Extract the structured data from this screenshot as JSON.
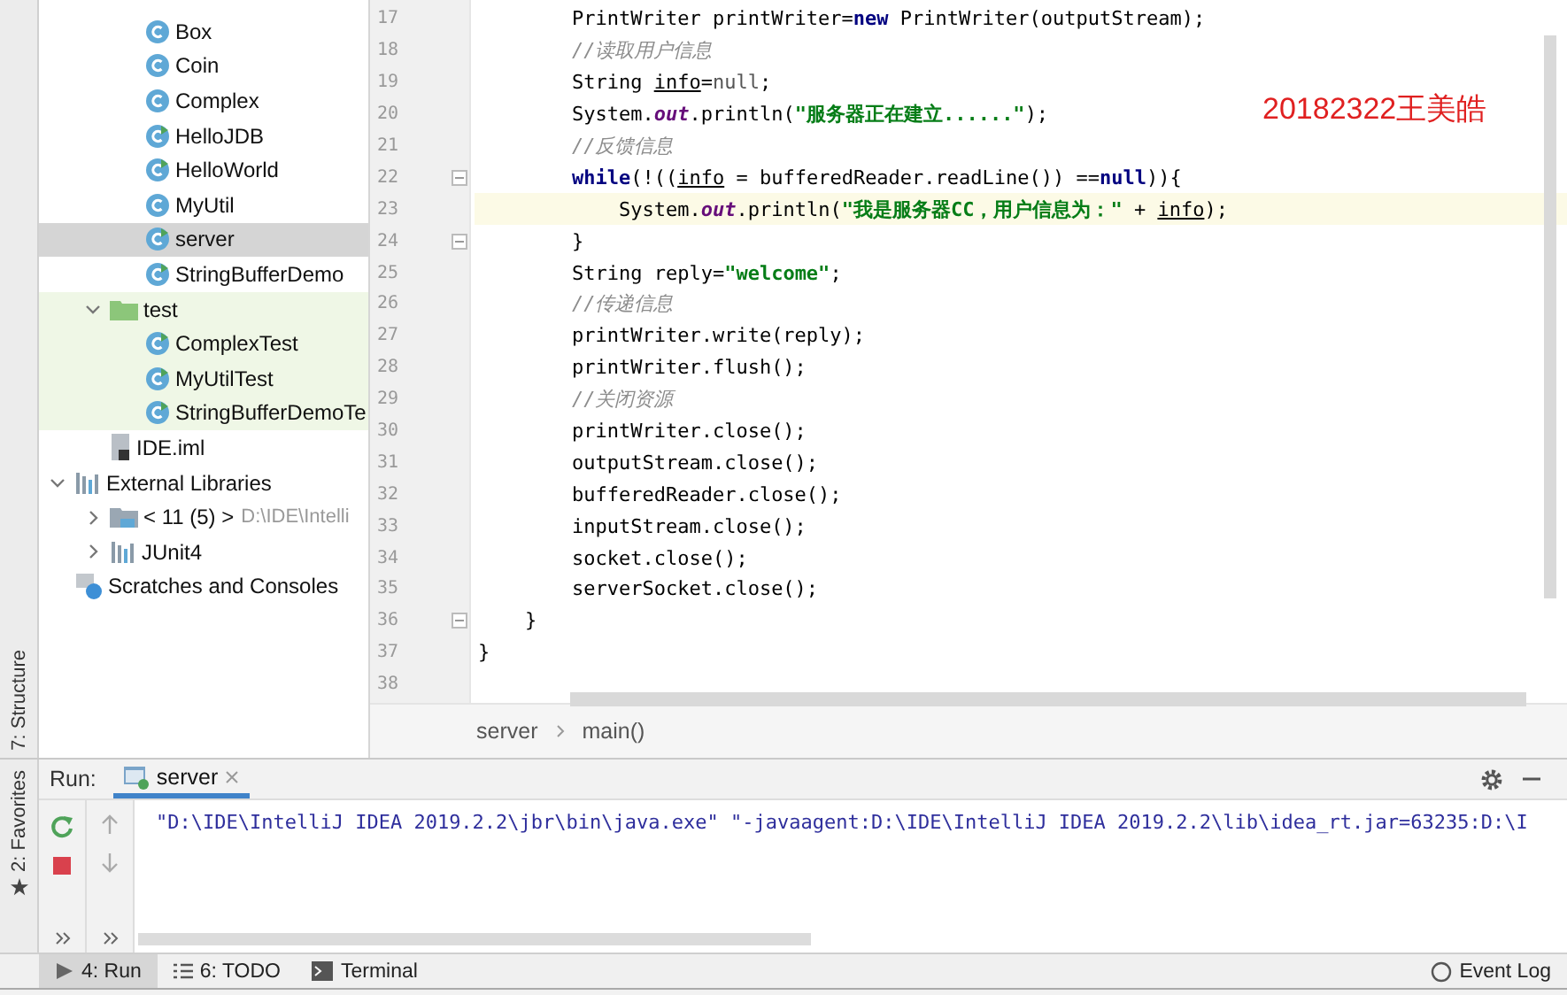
{
  "side_strip": {
    "top_tool": "7: Structure",
    "bottom_tool": "2: Favorites"
  },
  "project_tree": [
    {
      "children": [
        {
          "children": [
            {
              "label": "Box",
              "kind": "class",
              "selected": false
            },
            {
              "label": "Coin",
              "kind": "class",
              "selected": false
            },
            {
              "label": "Complex",
              "kind": "class",
              "selected": false
            },
            {
              "label": "HelloJDB",
              "kind": "runnable-class",
              "selected": false
            },
            {
              "label": "HelloWorld",
              "kind": "runnable-class",
              "selected": false
            },
            {
              "label": "MyUtil",
              "kind": "class",
              "selected": false
            },
            {
              "label": "server",
              "kind": "runnable-class",
              "selected": true
            },
            {
              "label": "StringBufferDemo",
              "kind": "runnable-class",
              "selected": false
            }
          ]
        },
        {
          "label": "test",
          "kind": "test-folder",
          "selected": false,
          "expanded": true,
          "children": [
            {
              "label": "ComplexTest",
              "kind": "runnable-class",
              "selected": false
            },
            {
              "label": "MyUtilTest",
              "kind": "runnable-class",
              "selected": false
            },
            {
              "label": "StringBufferDemoTe",
              "kind": "runnable-class",
              "selected": false
            }
          ]
        },
        {
          "label": "IDE.iml",
          "kind": "module-file",
          "selected": false
        }
      ]
    },
    {
      "label": "External Libraries",
      "kind": "libraries",
      "selected": false,
      "expanded": true,
      "children": [
        {
          "label": "< 11 (5) >",
          "hint": "D:\\IDE\\Intelli",
          "kind": "jdk",
          "selected": false,
          "expanded": false
        },
        {
          "label": "JUnit4",
          "kind": "library",
          "selected": false,
          "expanded": false
        }
      ]
    },
    {
      "label": "Scratches and Consoles",
      "kind": "scratches",
      "selected": false
    }
  ],
  "editor": {
    "annotation": "20182322王美皓",
    "lines": [
      {
        "number": "17",
        "fold": false,
        "current": false,
        "tokens": [
          {
            "kind": "plain",
            "text": "        PrintWriter printWriter="
          },
          {
            "kind": "keyword",
            "text": "new"
          },
          {
            "kind": "plain",
            "text": " PrintWriter(outputStream);"
          }
        ]
      },
      {
        "number": "18",
        "fold": false,
        "current": false,
        "tokens": [
          {
            "kind": "comment",
            "text": "        //读取用户信息"
          }
        ]
      },
      {
        "number": "19",
        "fold": false,
        "current": false,
        "tokens": [
          {
            "kind": "plain",
            "text": "        String "
          },
          {
            "kind": "variable",
            "text": "info"
          },
          {
            "kind": "plain",
            "text": "="
          },
          {
            "kind": "null",
            "text": "null"
          },
          {
            "kind": "plain",
            "text": ";"
          }
        ]
      },
      {
        "number": "20",
        "fold": false,
        "current": false,
        "tokens": [
          {
            "kind": "plain",
            "text": "        System."
          },
          {
            "kind": "field",
            "text": "out"
          },
          {
            "kind": "plain",
            "text": ".println("
          },
          {
            "kind": "string",
            "text": "\"服务器正在建立......\""
          },
          {
            "kind": "plain",
            "text": ");"
          }
        ]
      },
      {
        "number": "21",
        "fold": false,
        "current": false,
        "tokens": [
          {
            "kind": "comment",
            "text": "        //反馈信息"
          }
        ]
      },
      {
        "number": "22",
        "fold": true,
        "current": false,
        "tokens": [
          {
            "kind": "keyword",
            "text": "        while"
          },
          {
            "kind": "plain",
            "text": "(!(("
          },
          {
            "kind": "variable",
            "text": "info"
          },
          {
            "kind": "plain",
            "text": " = bufferedReader.readLine()) =="
          },
          {
            "kind": "keyword",
            "text": "null"
          },
          {
            "kind": "plain",
            "text": ")){"
          }
        ]
      },
      {
        "number": "23",
        "fold": false,
        "current": true,
        "tokens": [
          {
            "kind": "plain",
            "text": "            System."
          },
          {
            "kind": "field",
            "text": "out"
          },
          {
            "kind": "plain",
            "text": ".println("
          },
          {
            "kind": "string",
            "text": "\"我是服务器CC，用户信息为：\""
          },
          {
            "kind": "plain",
            "text": " + "
          },
          {
            "kind": "variable",
            "text": "info"
          },
          {
            "kind": "plain",
            "text": ");"
          }
        ]
      },
      {
        "number": "24",
        "fold": true,
        "current": false,
        "tokens": [
          {
            "kind": "plain",
            "text": "        }"
          }
        ]
      },
      {
        "number": "25",
        "fold": false,
        "current": false,
        "tokens": [
          {
            "kind": "plain",
            "text": "        String reply="
          },
          {
            "kind": "string",
            "text": "\"welcome\""
          },
          {
            "kind": "plain",
            "text": ";"
          }
        ]
      },
      {
        "number": "26",
        "fold": false,
        "current": false,
        "tokens": [
          {
            "kind": "comment",
            "text": "        //传递信息"
          }
        ]
      },
      {
        "number": "27",
        "fold": false,
        "current": false,
        "tokens": [
          {
            "kind": "plain",
            "text": "        printWriter.write(reply);"
          }
        ]
      },
      {
        "number": "28",
        "fold": false,
        "current": false,
        "tokens": [
          {
            "kind": "plain",
            "text": "        printWriter.flush();"
          }
        ]
      },
      {
        "number": "29",
        "fold": false,
        "current": false,
        "tokens": [
          {
            "kind": "comment",
            "text": "        //关闭资源"
          }
        ]
      },
      {
        "number": "30",
        "fold": false,
        "current": false,
        "tokens": [
          {
            "kind": "plain",
            "text": "        printWriter.close();"
          }
        ]
      },
      {
        "number": "31",
        "fold": false,
        "current": false,
        "tokens": [
          {
            "kind": "plain",
            "text": "        outputStream.close();"
          }
        ]
      },
      {
        "number": "32",
        "fold": false,
        "current": false,
        "tokens": [
          {
            "kind": "plain",
            "text": "        bufferedReader.close();"
          }
        ]
      },
      {
        "number": "33",
        "fold": false,
        "current": false,
        "tokens": [
          {
            "kind": "plain",
            "text": "        inputStream.close();"
          }
        ]
      },
      {
        "number": "34",
        "fold": false,
        "current": false,
        "tokens": [
          {
            "kind": "plain",
            "text": "        socket.close();"
          }
        ]
      },
      {
        "number": "35",
        "fold": false,
        "current": false,
        "tokens": [
          {
            "kind": "plain",
            "text": "        serverSocket.close();"
          }
        ]
      },
      {
        "number": "36",
        "fold": true,
        "current": false,
        "tokens": [
          {
            "kind": "plain",
            "text": "    }"
          }
        ]
      },
      {
        "number": "37",
        "fold": false,
        "current": false,
        "tokens": [
          {
            "kind": "plain",
            "text": "}"
          }
        ]
      },
      {
        "number": "38",
        "fold": false,
        "current": false
      }
    ],
    "breadcrumbs": [
      "server",
      "main()"
    ]
  },
  "run_panel": {
    "label": "Run:",
    "tab": "server",
    "console": [
      "\"D:\\IDE\\IntelliJ IDEA 2019.2.2\\jbr\\bin\\java.exe\" \"-javaagent:D:\\IDE\\IntelliJ IDEA 2019.2.2\\lib\\idea_rt.jar=63235:D:\\I"
    ]
  },
  "bottom_bar": {
    "tabs": [
      {
        "label": "4: Run",
        "kind": "run",
        "selected": true
      },
      {
        "label": "6: TODO",
        "kind": "todo",
        "selected": false
      },
      {
        "label": "Terminal",
        "kind": "terminal",
        "selected": false
      }
    ],
    "event_log": "Event Log"
  }
}
